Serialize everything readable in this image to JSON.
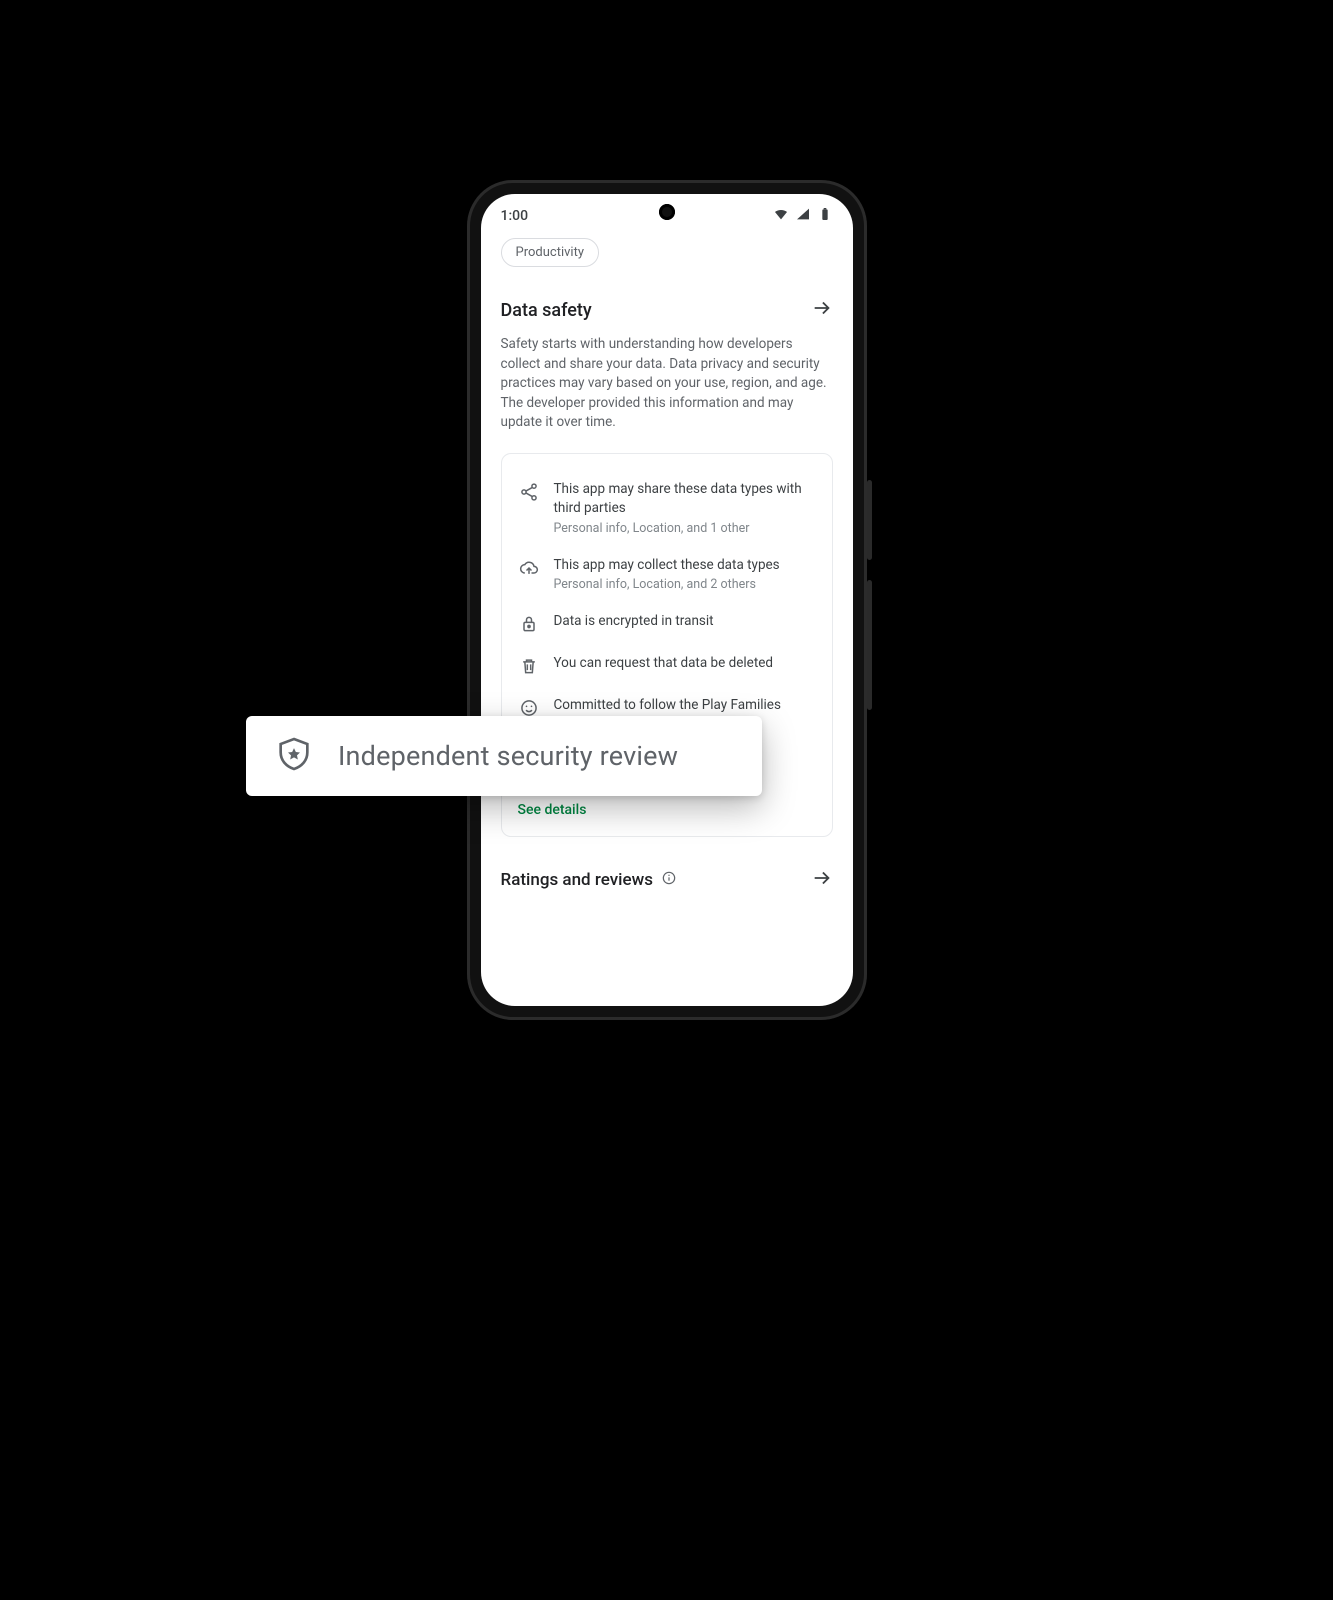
{
  "statusbar": {
    "time": "1:00"
  },
  "chip": {
    "label": "Productivity"
  },
  "data_safety": {
    "title": "Data safety",
    "body": "Safety starts with understanding how developers collect and share your data. Data privacy and security practices may vary based on your use, region, and age. The developer provided this information and may update it over time."
  },
  "safety_items": [
    {
      "title": "This app may share these data types with third parties",
      "sub": "Personal info, Location, and 1 other"
    },
    {
      "title": "This app may collect these data types",
      "sub": "Personal info, Location, and 2 others"
    },
    {
      "title": "Data is encrypted in transit",
      "sub": ""
    },
    {
      "title": "You can request that data be deleted",
      "sub": ""
    },
    {
      "title": "Committed to follow the Play Families Policy",
      "sub": ""
    }
  ],
  "see_details": "See details",
  "ratings": {
    "title": "Ratings and reviews"
  },
  "callout": {
    "label": "Independent security review"
  }
}
